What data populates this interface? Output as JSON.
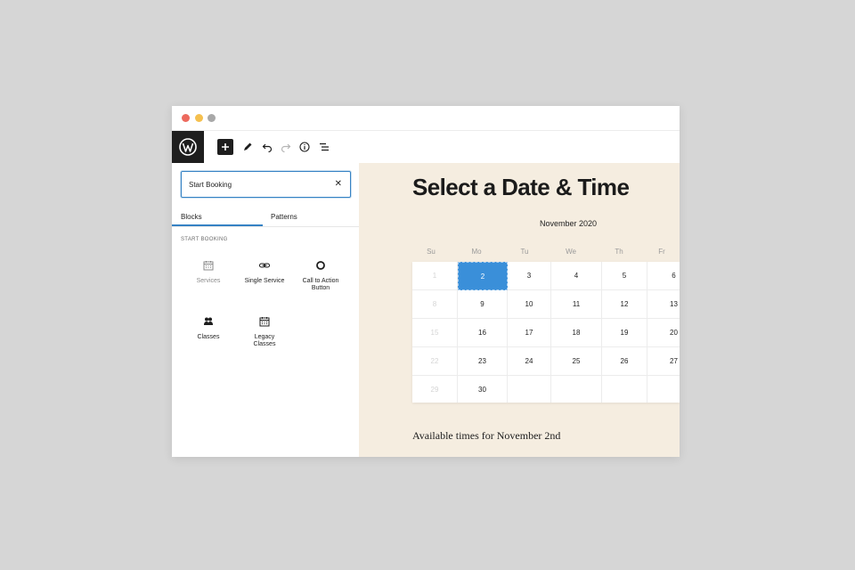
{
  "window": {
    "dots": [
      "#ed6a5e",
      "#f5c04f",
      "#a8a8a8"
    ]
  },
  "toolbar": {
    "logo_icon": "wordpress-icon",
    "tools": [
      "plus-icon",
      "pencil-icon",
      "undo-icon",
      "redo-icon",
      "info-icon",
      "list-view-icon"
    ]
  },
  "sidebar": {
    "search": {
      "value": "Start Booking",
      "clear_icon": "close-icon"
    },
    "tabs": [
      {
        "label": "Blocks",
        "active": true
      },
      {
        "label": "Patterns",
        "active": false
      }
    ],
    "section_title": "START BOOKING",
    "blocks": [
      {
        "label": "Services",
        "icon": "calendar-icon",
        "muted": true
      },
      {
        "label": "Single Service",
        "icon": "link-icon",
        "muted": false
      },
      {
        "label": "Call to Action Button",
        "icon": "circle-icon",
        "muted": false
      },
      {
        "label": "Classes",
        "icon": "group-icon",
        "muted": false
      },
      {
        "label": "Legacy Classes",
        "icon": "calendar-icon",
        "muted": false
      }
    ]
  },
  "main": {
    "heading": "Select a Date & Time",
    "calendar": {
      "month": "November 2020",
      "days_of_week": [
        "Su",
        "Mo",
        "Tu",
        "We",
        "Th",
        "Fr"
      ],
      "selected": "2",
      "rows": [
        [
          {
            "d": "1",
            "off": true
          },
          {
            "d": "2",
            "off": false
          },
          {
            "d": "3",
            "off": false
          },
          {
            "d": "4",
            "off": false
          },
          {
            "d": "5",
            "off": false
          },
          {
            "d": "6",
            "off": false
          }
        ],
        [
          {
            "d": "8",
            "off": true
          },
          {
            "d": "9",
            "off": false
          },
          {
            "d": "10",
            "off": false
          },
          {
            "d": "11",
            "off": false
          },
          {
            "d": "12",
            "off": false
          },
          {
            "d": "13",
            "off": false
          }
        ],
        [
          {
            "d": "15",
            "off": true
          },
          {
            "d": "16",
            "off": false
          },
          {
            "d": "17",
            "off": false
          },
          {
            "d": "18",
            "off": false
          },
          {
            "d": "19",
            "off": false
          },
          {
            "d": "20",
            "off": false
          }
        ],
        [
          {
            "d": "22",
            "off": true
          },
          {
            "d": "23",
            "off": false
          },
          {
            "d": "24",
            "off": false
          },
          {
            "d": "25",
            "off": false
          },
          {
            "d": "26",
            "off": false
          },
          {
            "d": "27",
            "off": false
          }
        ],
        [
          {
            "d": "29",
            "off": true
          },
          {
            "d": "30",
            "off": false
          },
          {
            "d": "",
            "off": false
          },
          {
            "d": "",
            "off": false
          },
          {
            "d": "",
            "off": false
          },
          {
            "d": "",
            "off": false
          }
        ]
      ]
    },
    "available_times_label": "Available times for November 2nd"
  },
  "colors": {
    "accent": "#3582c4",
    "selected_day": "#3a8fd9",
    "canvas_bg": "#f5ede0"
  }
}
